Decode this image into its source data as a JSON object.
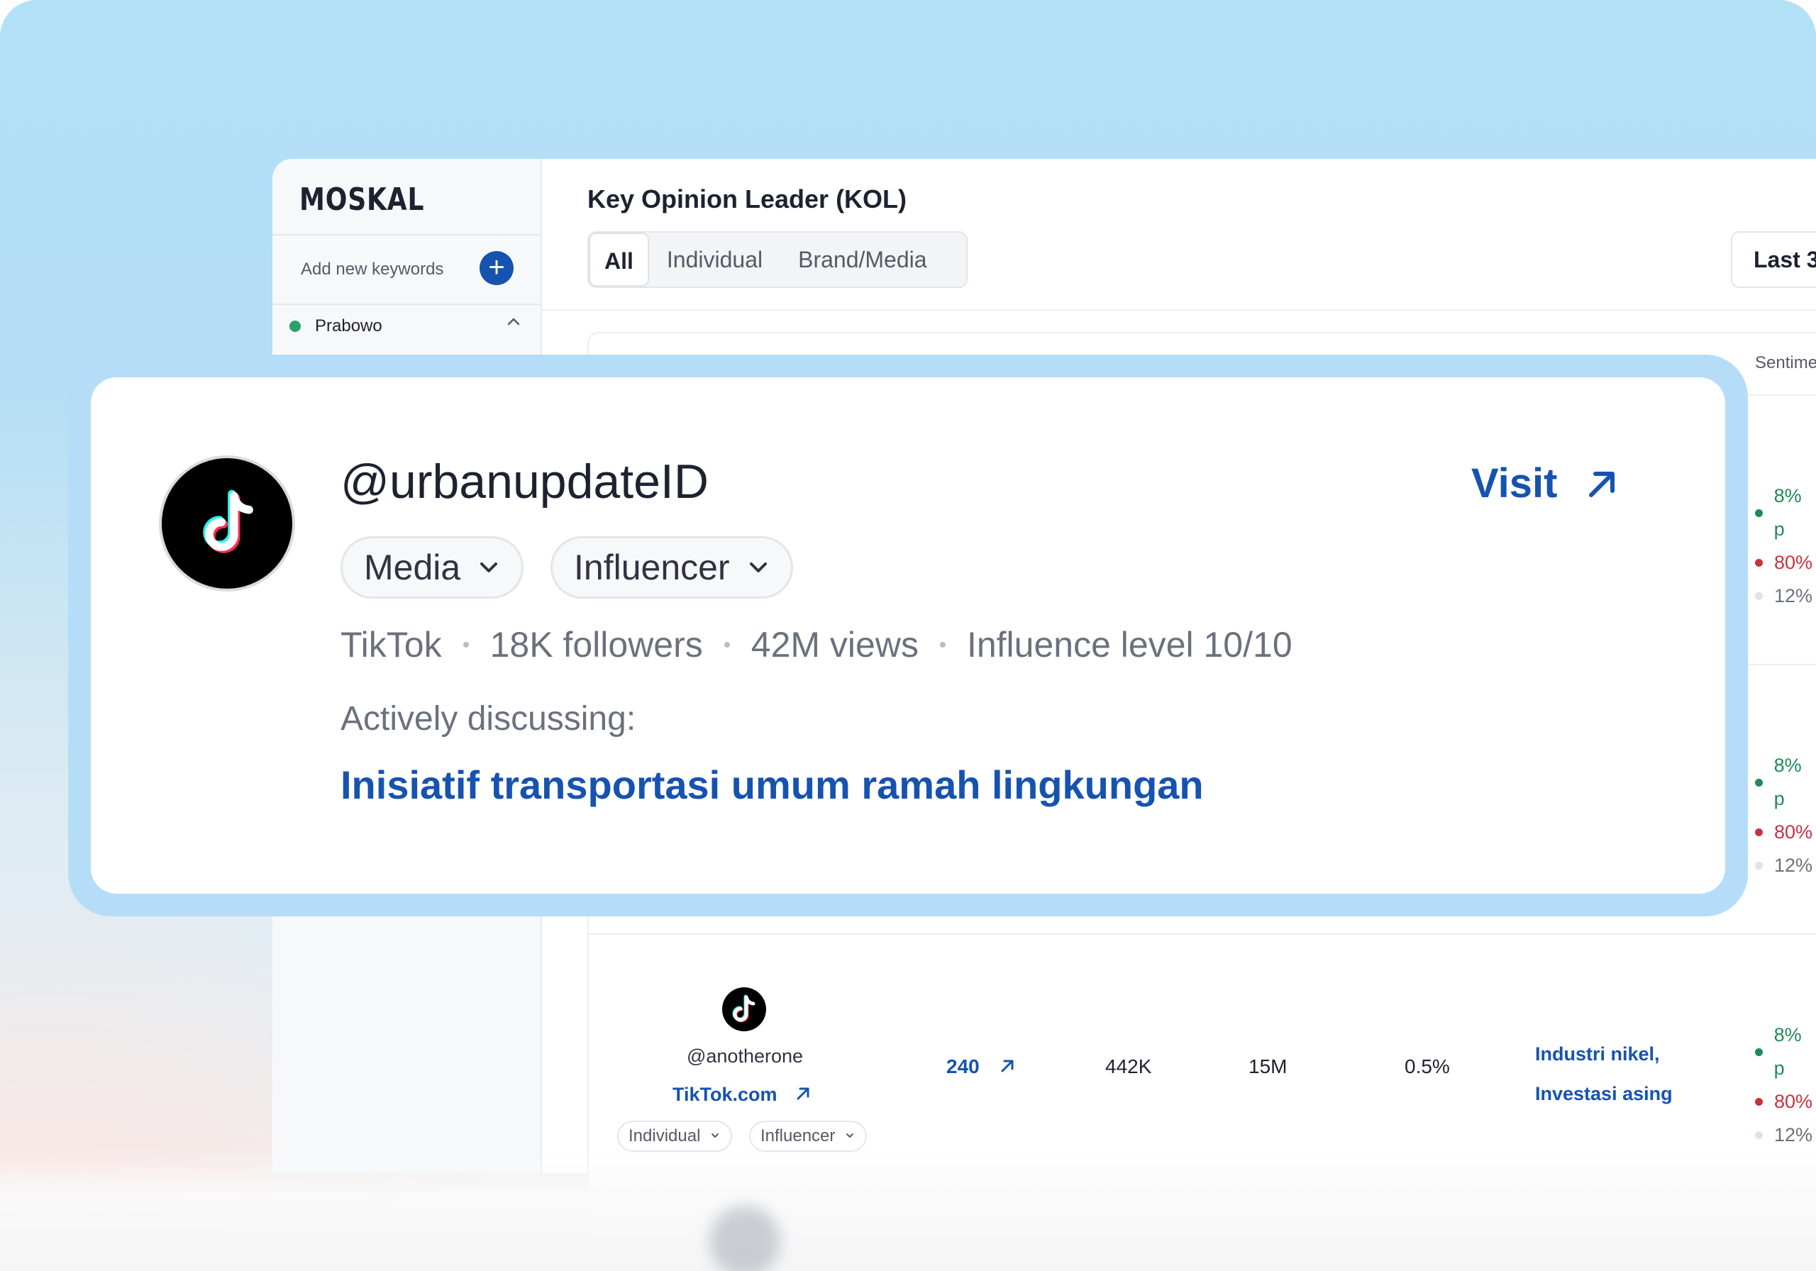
{
  "sidebar": {
    "logo": "MOSKAL",
    "add_keywords_label": "Add new keywords",
    "add_icon": "plus-icon",
    "keywords": [
      {
        "name": "Prabowo",
        "status_color": "#27a36a",
        "expanded": true
      }
    ]
  },
  "main": {
    "title": "Key Opinion Leader (KOL)",
    "tabs": [
      {
        "label": "All",
        "active": true
      },
      {
        "label": "Individual",
        "active": false
      },
      {
        "label": "Brand/Media",
        "active": false
      }
    ],
    "date_range_label": "Last 3",
    "table": {
      "sentiment_header": "Sentime",
      "rows": [
        {
          "sentiment": [
            "8% p",
            "80%",
            "12%"
          ]
        },
        {
          "sentiment": [
            "8% p",
            "80%",
            "12%"
          ]
        },
        {
          "handle": "@anotherone",
          "platform_link": "TikTok.com",
          "tags": [
            "Individual",
            "Influencer"
          ],
          "mentions": "240",
          "followers": "442K",
          "views": "15M",
          "engagement": "0.5%",
          "topics": [
            "Industri nikel,",
            "Investasi asing"
          ],
          "sentiment": [
            "8% p",
            "80%",
            "12%"
          ]
        }
      ]
    }
  },
  "highlight_card": {
    "handle": "@urbanupdateID",
    "visit_label": "Visit",
    "tags": [
      "Media",
      "Influencer"
    ],
    "platform": "TikTok",
    "followers": "18K followers",
    "views": "42M views",
    "influence": "Influence level 10/10",
    "discussing_label": "Actively discussing:",
    "topic": "Inisiatif transportasi umum ramah lingkungan"
  },
  "colors": {
    "accent": "#1653b0",
    "positive": "#1e8b57",
    "negative": "#c8323f",
    "highlight_border": "#b5ddf8"
  }
}
